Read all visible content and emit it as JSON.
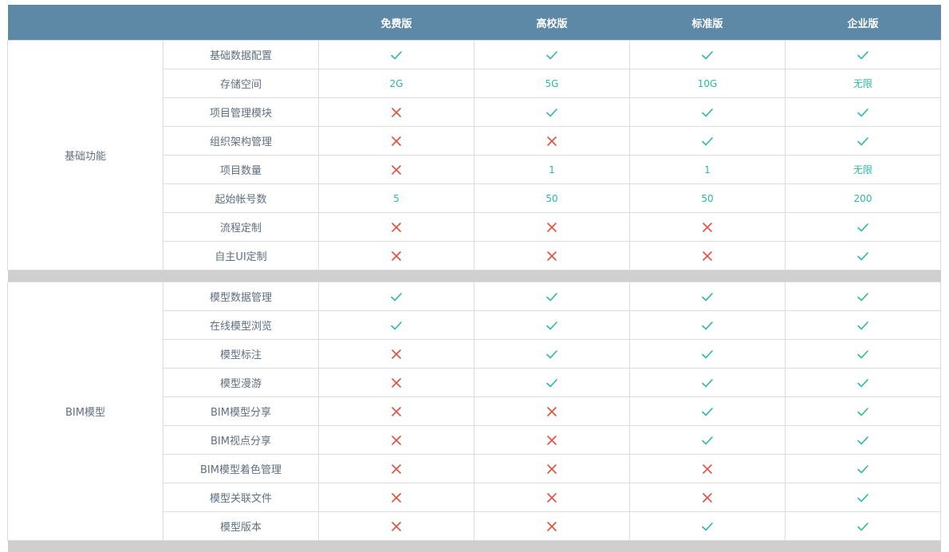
{
  "colors": {
    "header_bg": "#5d88a6",
    "check": "#2cb8a2",
    "cross": "#e0503f",
    "separator": "#cfcfcf"
  },
  "header": {
    "category": "",
    "feature": "",
    "plans": [
      "免费版",
      "高校版",
      "标准版",
      "企业版"
    ]
  },
  "sections": [
    {
      "category": "基础功能",
      "rows": [
        {
          "feature": "基础数据配置",
          "values": [
            "check",
            "check",
            "check",
            "check"
          ]
        },
        {
          "feature": "存储空间",
          "values": [
            "2G",
            "5G",
            "10G",
            "无限"
          ]
        },
        {
          "feature": "项目管理模块",
          "values": [
            "cross",
            "check",
            "check",
            "check"
          ]
        },
        {
          "feature": "组织架构管理",
          "values": [
            "cross",
            "cross",
            "check",
            "check"
          ]
        },
        {
          "feature": "项目数量",
          "values": [
            "cross",
            "1",
            "1",
            "无限"
          ]
        },
        {
          "feature": "起始帐号数",
          "values": [
            "5",
            "50",
            "50",
            "200"
          ]
        },
        {
          "feature": "流程定制",
          "values": [
            "cross",
            "cross",
            "cross",
            "check"
          ]
        },
        {
          "feature": "自主UI定制",
          "values": [
            "cross",
            "cross",
            "cross",
            "check"
          ]
        }
      ]
    },
    {
      "category": "BIM模型",
      "rows": [
        {
          "feature": "模型数据管理",
          "values": [
            "check",
            "check",
            "check",
            "check"
          ]
        },
        {
          "feature": "在线模型浏览",
          "values": [
            "check",
            "check",
            "check",
            "check"
          ]
        },
        {
          "feature": "模型标注",
          "values": [
            "cross",
            "check",
            "check",
            "check"
          ]
        },
        {
          "feature": "模型漫游",
          "values": [
            "cross",
            "check",
            "check",
            "check"
          ]
        },
        {
          "feature": "BIM模型分享",
          "values": [
            "cross",
            "cross",
            "check",
            "check"
          ]
        },
        {
          "feature": "BIM视点分享",
          "values": [
            "cross",
            "cross",
            "check",
            "check"
          ]
        },
        {
          "feature": "BIM模型着色管理",
          "values": [
            "cross",
            "cross",
            "cross",
            "check"
          ]
        },
        {
          "feature": "模型关联文件",
          "values": [
            "cross",
            "cross",
            "cross",
            "check"
          ]
        },
        {
          "feature": "模型版本",
          "values": [
            "cross",
            "cross",
            "check",
            "check"
          ]
        }
      ]
    }
  ]
}
